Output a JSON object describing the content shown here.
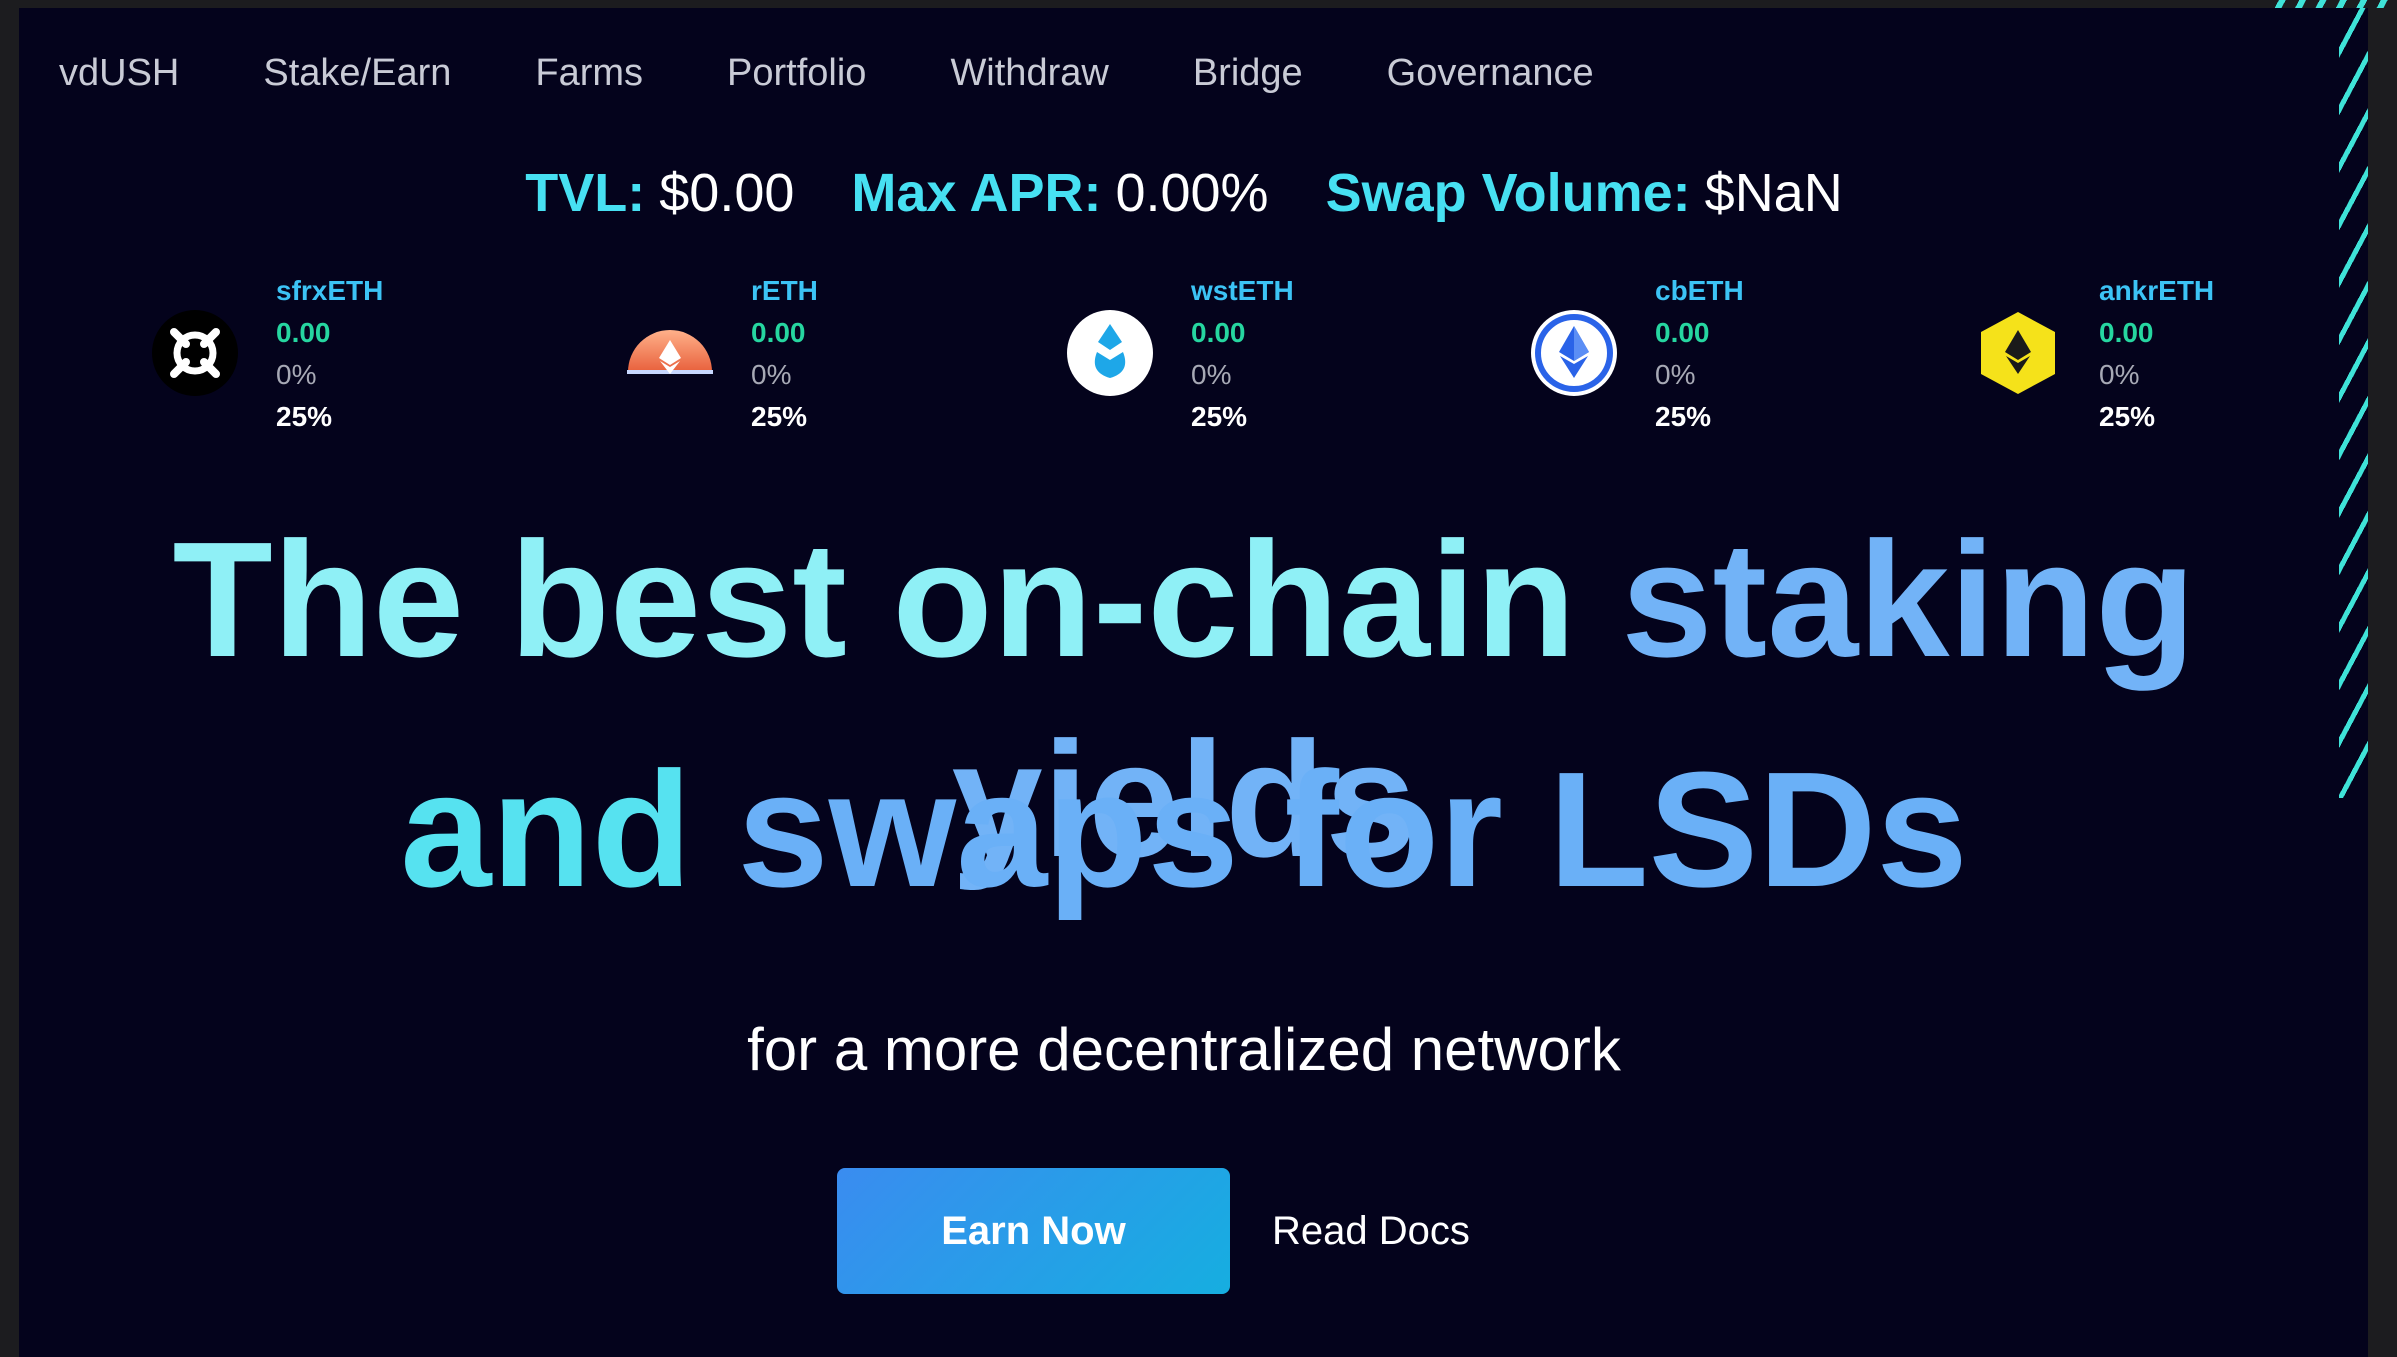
{
  "nav": {
    "items": [
      {
        "label": "vdUSH"
      },
      {
        "label": "Stake/Earn"
      },
      {
        "label": "Farms"
      },
      {
        "label": "Portfolio"
      },
      {
        "label": "Withdraw"
      },
      {
        "label": "Bridge"
      },
      {
        "label": "Governance"
      }
    ]
  },
  "stats": {
    "tvl_label": "TVL:",
    "tvl_value": "$0.00",
    "apr_label": "Max APR:",
    "apr_value": "0.00%",
    "volume_label": "Swap Volume:",
    "volume_value": "$NaN"
  },
  "tokens": [
    {
      "name": "sfrxETH",
      "amount": "0.00",
      "apr": "0%",
      "share": "25%",
      "icon": "frax-icon"
    },
    {
      "name": "rETH",
      "amount": "0.00",
      "apr": "0%",
      "share": "25%",
      "icon": "rocketpool-icon"
    },
    {
      "name": "wstETH",
      "amount": "0.00",
      "apr": "0%",
      "share": "25%",
      "icon": "lido-icon"
    },
    {
      "name": "cbETH",
      "amount": "0.00",
      "apr": "0%",
      "share": "25%",
      "icon": "coinbase-eth-icon"
    },
    {
      "name": "ankrETH",
      "amount": "0.00",
      "apr": "0%",
      "share": "25%",
      "icon": "ankr-icon"
    }
  ],
  "hero": {
    "line1_a": "The best on-chain ",
    "line1_b": "staking yields",
    "line2_a": "and ",
    "line2_b": "swaps for LSDs",
    "subtitle": "for a more decentralized network"
  },
  "cta": {
    "earn_label": "Earn Now",
    "docs_label": "Read Docs"
  },
  "colors": {
    "background": "#04031c",
    "accent_cyan": "#47e0f2",
    "accent_green": "#26d6a0",
    "button": "#2a9de8"
  }
}
